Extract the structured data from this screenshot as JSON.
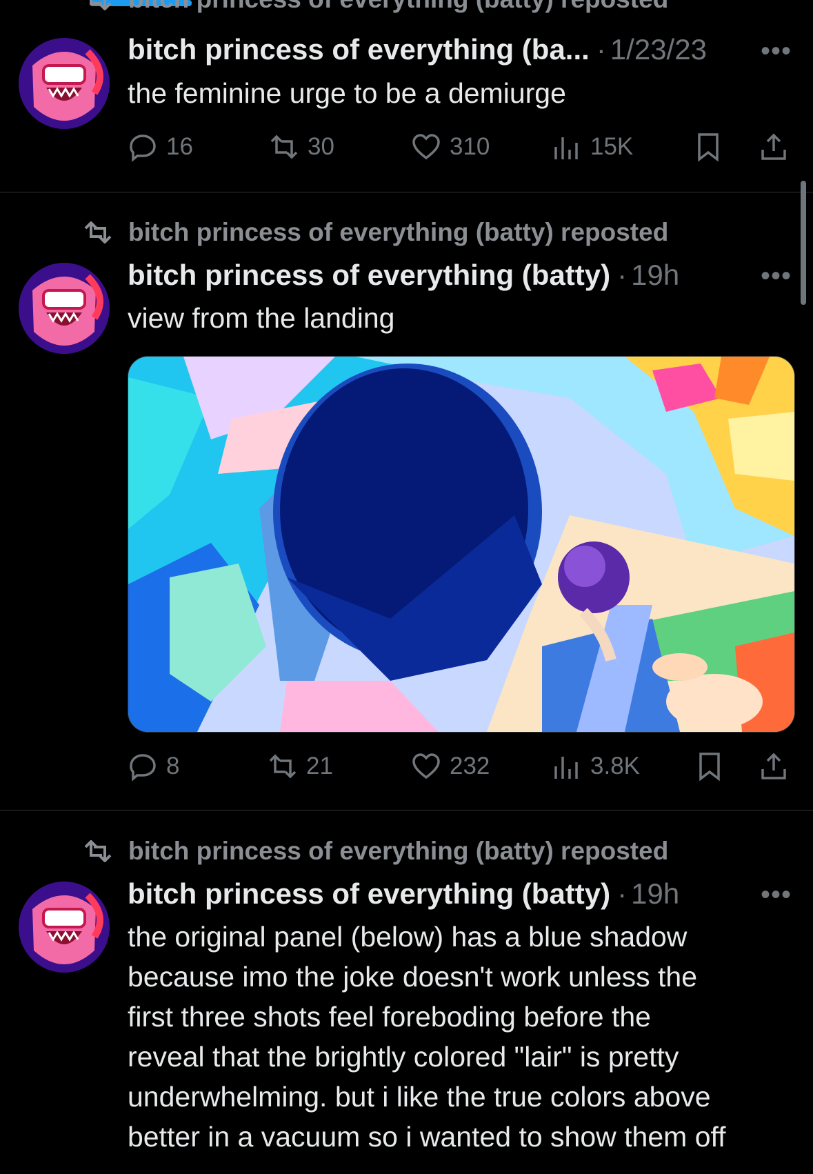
{
  "top_tab_indicator_color": "#1d9bf0",
  "posts": [
    {
      "repost_label": "bitch princess of everything (batty) reposted",
      "author": "bitch princess of everything (ba...",
      "separator": "·",
      "time": "1/23/23",
      "more_label": "•••",
      "text": "the feminine urge to be a demiurge",
      "stats": {
        "replies": "16",
        "reposts": "30",
        "likes": "310",
        "views": "15K"
      }
    },
    {
      "repost_label": "bitch princess of everything (batty) reposted",
      "author": "bitch princess of everything (batty)",
      "separator": "·",
      "time": "19h",
      "more_label": "•••",
      "text": "view from the landing",
      "stats": {
        "replies": "8",
        "reposts": "21",
        "likes": "232",
        "views": "3.8K"
      }
    },
    {
      "repost_label": "bitch princess of everything (batty) reposted",
      "author": "bitch princess of everything (batty)",
      "separator": "·",
      "time": "19h",
      "more_label": "•••",
      "text_lines": [
        "the original panel (below) has a blue shadow",
        "because imo the joke doesn't work unless the",
        "first three shots feel foreboding before the",
        "reveal that the brightly colored \"lair\" is pretty",
        "underwhelming. but i like the true colors above",
        "better in a vacuum so i wanted to show them off"
      ]
    }
  ],
  "icons": [
    "repost-icon",
    "reply-icon",
    "like-icon",
    "views-icon",
    "bookmark-icon",
    "share-icon",
    "more-icon"
  ]
}
